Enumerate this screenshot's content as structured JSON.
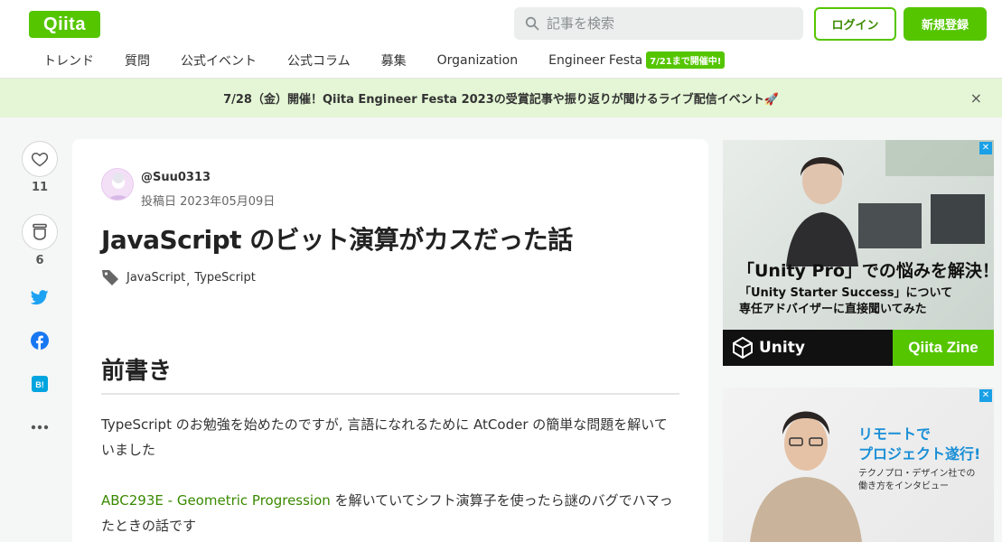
{
  "header": {
    "logo": "Qiita",
    "search_placeholder": "記事を検索",
    "login_label": "ログイン",
    "signup_label": "新規登録",
    "nav": [
      "トレンド",
      "質問",
      "公式イベント",
      "公式コラム",
      "募集",
      "Organization",
      "Engineer Festa"
    ],
    "festa_badge": "7/21まで開催中!"
  },
  "announcement": {
    "text": "7/28（金）開催！Qiita Engineer Festa 2023の受賞記事や振り返りが聞けるライブ配信イベント🚀",
    "close": "×"
  },
  "sidebar": {
    "like_count": "11",
    "stock_count": "6"
  },
  "article": {
    "author": "@Suu0313",
    "posted": "投稿日 2023年05月09日",
    "title": "JavaScript のビット演算がカスだった話",
    "tags": [
      "JavaScript",
      "TypeScript"
    ],
    "tag_separator": ",",
    "heading": "前書き",
    "para1": "TypeScript のお勉強を始めたのですが, 言語になれるために AtCoder の簡単な問題を解いていました",
    "para2_link": "ABC293E - Geometric Progression",
    "para2_rest": " を解いていてシフト演算子を使ったら謎のバグでハマったときの話です"
  },
  "ads": {
    "ad1_line1": "「Unity Pro」での悩みを解決！",
    "ad1_line2": "「Unity Starter Success」について",
    "ad1_line3": "専任アドバイザーに直接聞いてみた",
    "ad1_unity": "Unity",
    "ad1_zine": "Qiita Zine",
    "ad2_line1": "リモートで",
    "ad2_line2": "プロジェクト遂行!",
    "ad2_line3": "テクノプロ・デザイン社での",
    "ad2_line4": "働き方をインタビュー",
    "ad_mark": "✕"
  },
  "colors": {
    "brand": "#55c500",
    "link": "#3a8a00",
    "announce_bg": "#e4f6d5"
  }
}
